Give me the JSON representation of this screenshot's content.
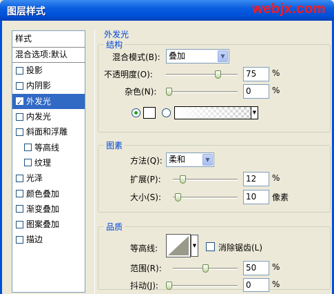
{
  "window": {
    "title": "图层样式",
    "watermark": "webjx.com"
  },
  "style_list": {
    "header": "样式",
    "blend_options": "混合选项:默认",
    "items": [
      {
        "label": "投影",
        "checked": false,
        "sub": false,
        "selected": false
      },
      {
        "label": "内阴影",
        "checked": false,
        "sub": false,
        "selected": false
      },
      {
        "label": "外发光",
        "checked": true,
        "sub": false,
        "selected": true
      },
      {
        "label": "内发光",
        "checked": false,
        "sub": false,
        "selected": false
      },
      {
        "label": "斜面和浮雕",
        "checked": false,
        "sub": false,
        "selected": false
      },
      {
        "label": "等高线",
        "checked": false,
        "sub": true,
        "selected": false
      },
      {
        "label": "纹理",
        "checked": false,
        "sub": true,
        "selected": false
      },
      {
        "label": "光泽",
        "checked": false,
        "sub": false,
        "selected": false
      },
      {
        "label": "颜色叠加",
        "checked": false,
        "sub": false,
        "selected": false
      },
      {
        "label": "渐变叠加",
        "checked": false,
        "sub": false,
        "selected": false
      },
      {
        "label": "图案叠加",
        "checked": false,
        "sub": false,
        "selected": false
      },
      {
        "label": "描边",
        "checked": false,
        "sub": false,
        "selected": false
      }
    ]
  },
  "outer_glow": {
    "title": "外发光",
    "structure": {
      "legend": "结构",
      "blend_mode_label": "混合模式(B):",
      "blend_mode_value": "叠加",
      "opacity_label": "不透明度(O):",
      "opacity_value": "75",
      "opacity_unit": "%",
      "opacity_level": 0.75,
      "noise_label": "杂色(N):",
      "noise_value": "0",
      "noise_unit": "%",
      "noise_level": 0
    },
    "elements": {
      "legend": "图素",
      "method_label": "方法(Q):",
      "method_value": "柔和",
      "spread_label": "扩展(P):",
      "spread_value": "12",
      "spread_unit": "%",
      "spread_level": 0.12,
      "size_label": "大小(S):",
      "size_value": "10",
      "size_unit": "像素",
      "size_level": 0.04
    },
    "quality": {
      "legend": "品质",
      "contour_label": "等高线:",
      "antialias_label": "消除锯齿(L)",
      "range_label": "范围(R):",
      "range_value": "50",
      "range_unit": "%",
      "range_level": 0.5,
      "jitter_label": "抖动(J):",
      "jitter_value": "0",
      "jitter_unit": "%",
      "jitter_level": 0
    }
  }
}
